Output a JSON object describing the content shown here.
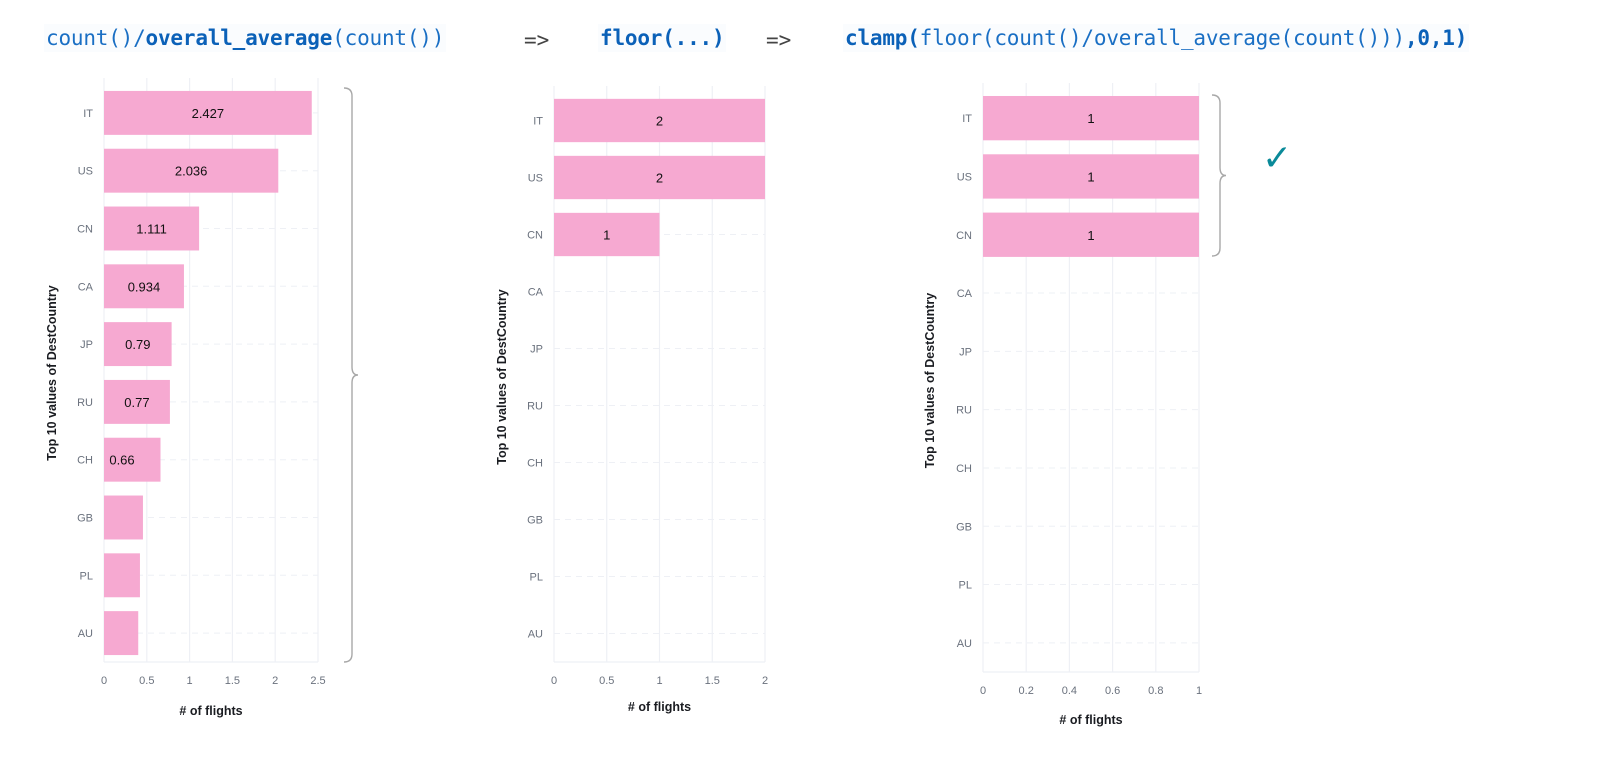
{
  "header": {
    "formula1": {
      "p1": "count()/",
      "p2": "overall_average",
      "p3": "(count())"
    },
    "arrow1": "=>",
    "formula2": "floor(...)",
    "arrow2": "=>",
    "formula3": {
      "p1": "clamp(",
      "p2": "floor(count()/overall_average(count()))",
      "p3": ",0,1)"
    }
  },
  "check_icon": "✓",
  "colors": {
    "bar": "#f6a9d1",
    "grid": "#eef0f5",
    "brace": "#a8a8a8",
    "check": "#0a8a99",
    "formula": "#1a6fc4"
  },
  "chart_data": [
    {
      "type": "bar",
      "orientation": "horizontal",
      "categories": [
        "IT",
        "US",
        "CN",
        "CA",
        "JP",
        "RU",
        "CH",
        "GB",
        "PL",
        "AU"
      ],
      "values": [
        2.427,
        2.036,
        1.111,
        0.934,
        0.79,
        0.77,
        0.66,
        0.455,
        0.42,
        0.4
      ],
      "labels": [
        "2.427",
        "2.036",
        "1.111",
        "0.934",
        "0.79",
        "0.77",
        "0.66",
        "",
        "",
        ""
      ],
      "xticks": [
        "0",
        "0.5",
        "1",
        "1.5",
        "2",
        "2.5"
      ],
      "xlim": [
        0,
        2.5
      ],
      "xlabel": "# of flights",
      "ylabel": "Top 10 values of DestCountry",
      "grid": true,
      "bracket": "all"
    },
    {
      "type": "bar",
      "orientation": "horizontal",
      "categories": [
        "IT",
        "US",
        "CN",
        "CA",
        "JP",
        "RU",
        "CH",
        "GB",
        "PL",
        "AU"
      ],
      "values": [
        2,
        2,
        1,
        0,
        0,
        0,
        0,
        0,
        0,
        0
      ],
      "labels": [
        "2",
        "2",
        "1",
        "",
        "",
        "",
        "",
        "",
        "",
        ""
      ],
      "xticks": [
        "0",
        "0.5",
        "1",
        "1.5",
        "2"
      ],
      "xlim": [
        0,
        2
      ],
      "xlabel": "# of flights",
      "ylabel": "Top 10 values of DestCountry",
      "grid": true
    },
    {
      "type": "bar",
      "orientation": "horizontal",
      "categories": [
        "IT",
        "US",
        "CN",
        "CA",
        "JP",
        "RU",
        "CH",
        "GB",
        "PL",
        "AU"
      ],
      "values": [
        1,
        1,
        1,
        0,
        0,
        0,
        0,
        0,
        0,
        0
      ],
      "labels": [
        "1",
        "1",
        "1",
        "",
        "",
        "",
        "",
        "",
        "",
        ""
      ],
      "xticks": [
        "0",
        "0.2",
        "0.4",
        "0.6",
        "0.8",
        "1"
      ],
      "xlim": [
        0,
        1
      ],
      "xlabel": "# of flights",
      "ylabel": "Top 10 values of DestCountry",
      "grid": true,
      "bracket": "top3"
    }
  ]
}
